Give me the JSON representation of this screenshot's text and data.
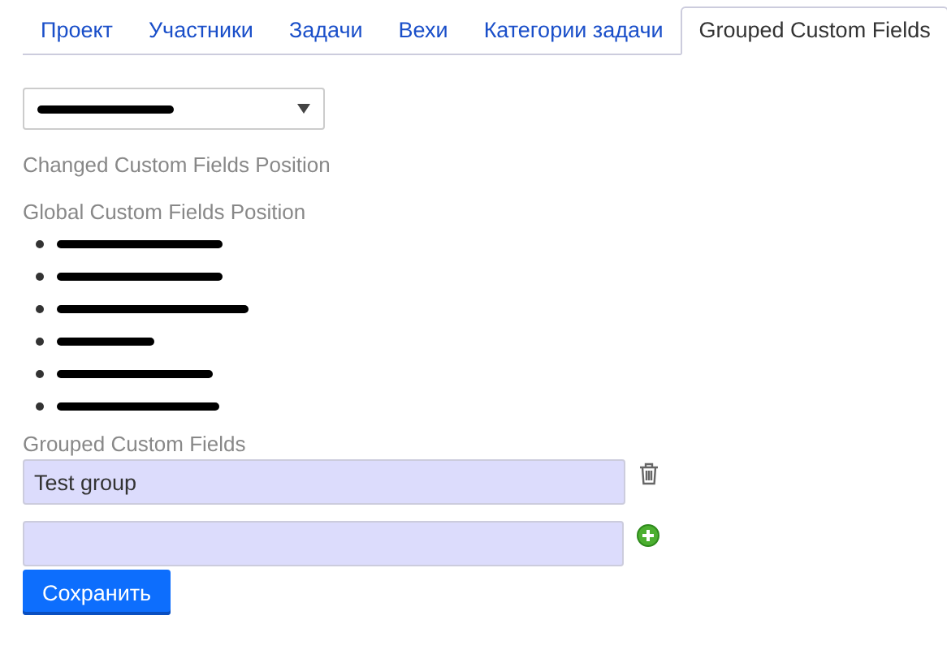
{
  "tabs": [
    {
      "label": "Проект",
      "selected": false
    },
    {
      "label": "Участники",
      "selected": false
    },
    {
      "label": "Задачи",
      "selected": false
    },
    {
      "label": "Вехи",
      "selected": false
    },
    {
      "label": "Категории задачи",
      "selected": false
    },
    {
      "label": "Grouped Custom Fields",
      "selected": true
    }
  ],
  "tracker_select": {
    "redacted": true
  },
  "changed_heading": "Changed Custom Fields Position",
  "global_heading": "Global Custom Fields Position",
  "global_fields": [
    {
      "redacted": true
    },
    {
      "redacted": true
    },
    {
      "redacted": true
    },
    {
      "redacted": true
    },
    {
      "redacted": true
    },
    {
      "redacted": true
    }
  ],
  "grouped_heading": "Grouped Custom Fields",
  "groups": [
    {
      "value": "Test group"
    }
  ],
  "save_button": "Сохранить"
}
